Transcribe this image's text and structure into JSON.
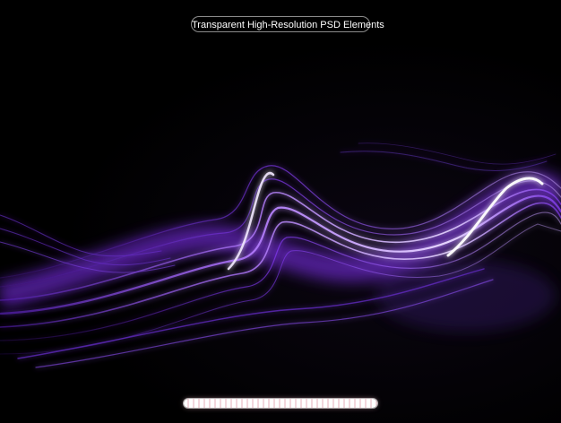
{
  "badge": {
    "text": "Transparent High-Resolution PSD Elements"
  },
  "colors": {
    "background": "#000000",
    "wave_primary": "#8a3dff",
    "wave_highlight": "#e6d6ff",
    "wave_secondary": "#5a1fbf"
  },
  "icons": {
    "bottom_bar": "progress-bar-graphic"
  }
}
